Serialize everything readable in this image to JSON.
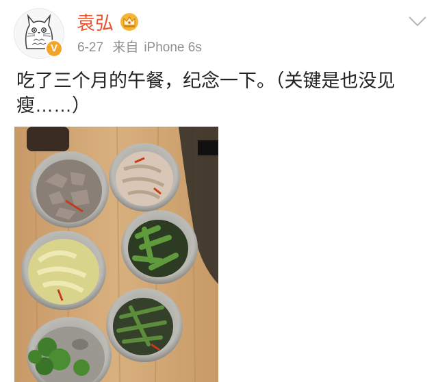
{
  "user": {
    "name": "袁弘",
    "verified_badge": "V",
    "crown_icon": "crown-icon",
    "avatar_icon": "totoro-avatar"
  },
  "meta": {
    "date": "6-27",
    "source_prefix": "来自",
    "device": "iPhone 6s"
  },
  "post": {
    "text": "吃了三个月的午餐，纪念一下。（关键是也没见瘦……）"
  },
  "photo": {
    "subject": "lunch-boxes-on-wooden-table"
  },
  "colors": {
    "username": "#e8562f",
    "meta": "#8f8f8f",
    "badge": "#f3a52a"
  }
}
